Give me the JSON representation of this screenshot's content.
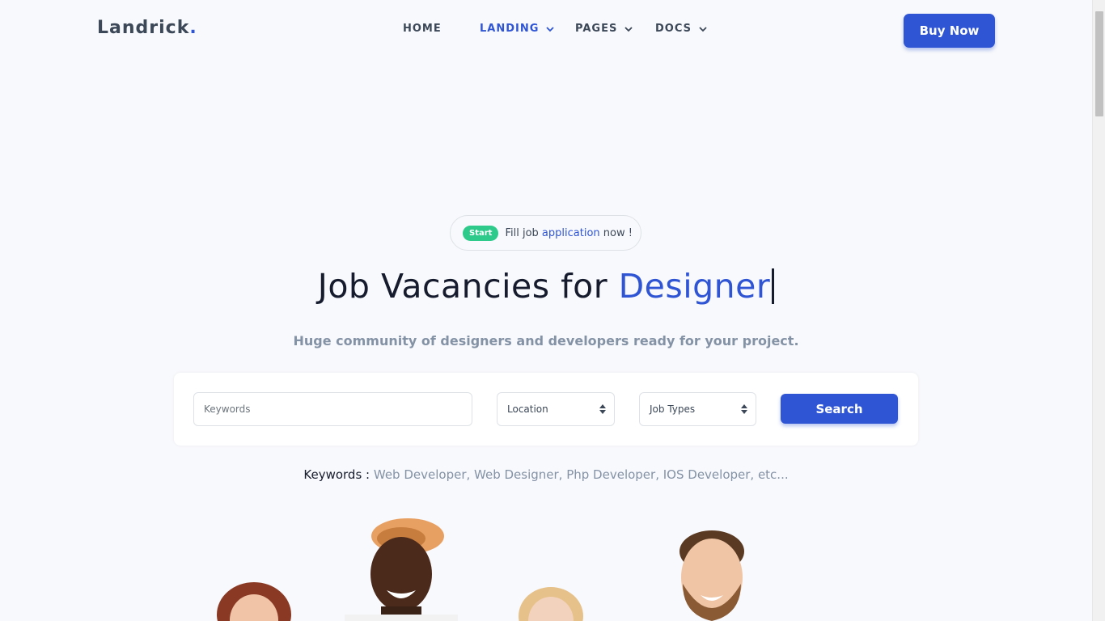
{
  "brand": {
    "name": "Landrick",
    "dot": "."
  },
  "nav": {
    "items": [
      {
        "label": "HOME",
        "dropdown": false,
        "active": false
      },
      {
        "label": "LANDING",
        "dropdown": true,
        "active": true
      },
      {
        "label": "PAGES",
        "dropdown": true,
        "active": false
      },
      {
        "label": "DOCS",
        "dropdown": true,
        "active": false
      }
    ],
    "cta_label": "Buy Now"
  },
  "hero": {
    "pill_badge": "Start",
    "pill_text_before": "Fill job",
    "pill_link": "application",
    "pill_text_after": "now !",
    "title_prefix": "Job Vacancies for",
    "title_typed": "Designer",
    "subtitle": "Huge community of designers and developers ready for your project."
  },
  "search": {
    "keywords_placeholder": "Keywords",
    "location_value": "Location",
    "job_types_value": "Job Types",
    "button_label": "Search"
  },
  "keywords_hint": {
    "label": "Keywords :",
    "list": "Web Developer, Web Designer, Php Developer, IOS Developer, etc..."
  },
  "colors": {
    "primary": "#2f55d4",
    "success": "#2eca8b",
    "dark": "#161c2d",
    "muted": "#8492a6",
    "background": "#f8f9fc"
  }
}
